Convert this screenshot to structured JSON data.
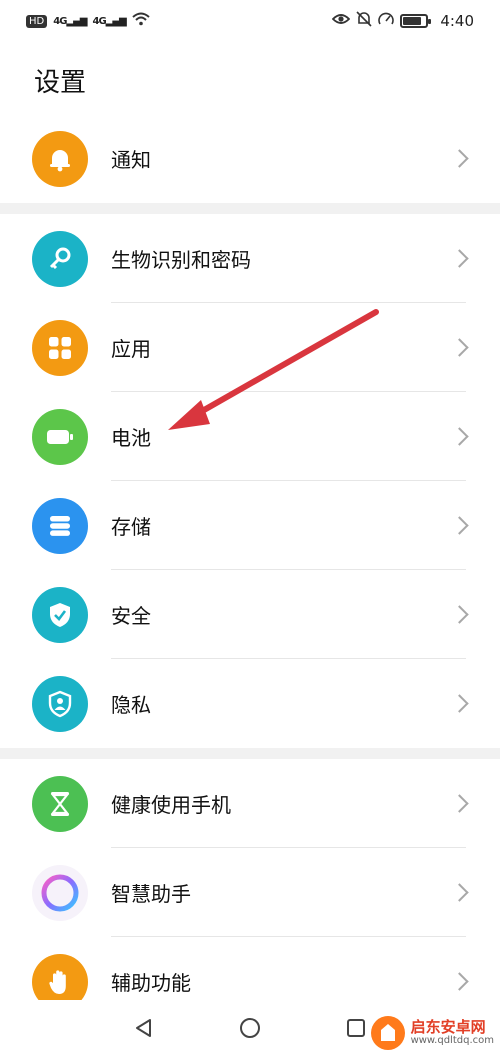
{
  "status_bar": {
    "hd": "HD",
    "signal1": "4G",
    "signal2": "4G",
    "time": "4:40",
    "battery_level": 0.75
  },
  "page": {
    "title": "设置"
  },
  "groups": [
    {
      "items": [
        {
          "label": "通知",
          "icon": "bell-icon",
          "color": "#f39a12"
        }
      ]
    },
    {
      "items": [
        {
          "label": "生物识别和密码",
          "icon": "key-icon",
          "color": "#1bb3c7"
        },
        {
          "label": "应用",
          "icon": "apps-grid-icon",
          "color": "#f39a12"
        },
        {
          "label": "电池",
          "icon": "battery-icon",
          "color": "#5cc64a"
        },
        {
          "label": "存储",
          "icon": "storage-icon",
          "color": "#2b93ef"
        },
        {
          "label": "安全",
          "icon": "shield-check-icon",
          "color": "#1bb3c7"
        },
        {
          "label": "隐私",
          "icon": "privacy-shield-icon",
          "color": "#1bb3c7"
        }
      ]
    },
    {
      "items": [
        {
          "label": "健康使用手机",
          "icon": "hourglass-icon",
          "color": "#4cc053"
        },
        {
          "label": "智慧助手",
          "icon": "assistant-orb-icon",
          "color": "#ffffff"
        },
        {
          "label": "辅助功能",
          "icon": "hand-icon",
          "color": "#f39a12"
        }
      ]
    }
  ],
  "watermark": {
    "name": "启东安卓网",
    "url": "www.qdltdq.com"
  }
}
